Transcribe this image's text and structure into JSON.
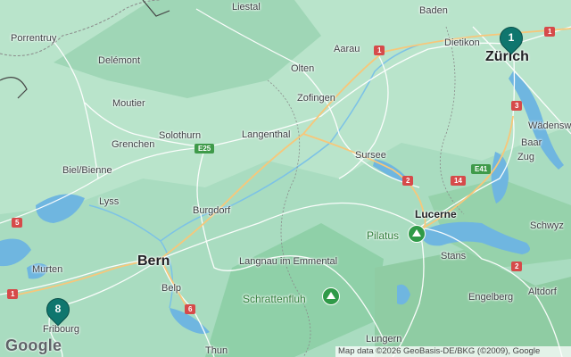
{
  "map": {
    "towns": {
      "liestal": "Liestal",
      "baden": "Baden",
      "porrentruy": "Porrentruy",
      "dietikon": "Dietikon",
      "zurich": "Zürich",
      "delemont": "Delémont",
      "olten": "Olten",
      "aarau": "Aarau",
      "moutier": "Moutier",
      "zofingen": "Zofingen",
      "wadenswil": "Wädenswil",
      "solothurn": "Solothurn",
      "langenthal": "Langenthal",
      "grenchen": "Grenchen",
      "baar": "Baar",
      "sursee": "Sursee",
      "zug": "Zug",
      "biel": "Biel/Bienne",
      "lyss": "Lyss",
      "burgdorf": "Burgdorf",
      "lucerne": "Lucerne",
      "schwyz": "Schwyz",
      "stans": "Stans",
      "murten": "Murten",
      "bern": "Bern",
      "langnau": "Langnau im Emmental",
      "belp": "Belp",
      "altdorf": "Altdorf",
      "engelberg": "Engelberg",
      "fribourg": "Fribourg",
      "thun": "Thun",
      "lungern": "Lungern"
    },
    "peaks": {
      "pilatus": "Pilatus",
      "schrattenfluh": "Schrattenfluh"
    },
    "road_shields": [
      "1",
      "1",
      "3",
      "E25",
      "E41",
      "2",
      "14",
      "5",
      "2",
      "6",
      "1"
    ],
    "markers": [
      {
        "label": "1",
        "color": "#0f766e"
      },
      {
        "label": "8",
        "color": "#0f766e"
      }
    ],
    "logo": "Google",
    "attribution": "Map data ©2026 GeoBasis-DE/BKG (©2009), Google",
    "colors": {
      "terrain": "#a9dcc0",
      "forest": "#8fd0a8",
      "water": "#6fb6e0",
      "road": "#ffffff",
      "highway": "#f7c77a",
      "marker": "#0f766e"
    }
  }
}
